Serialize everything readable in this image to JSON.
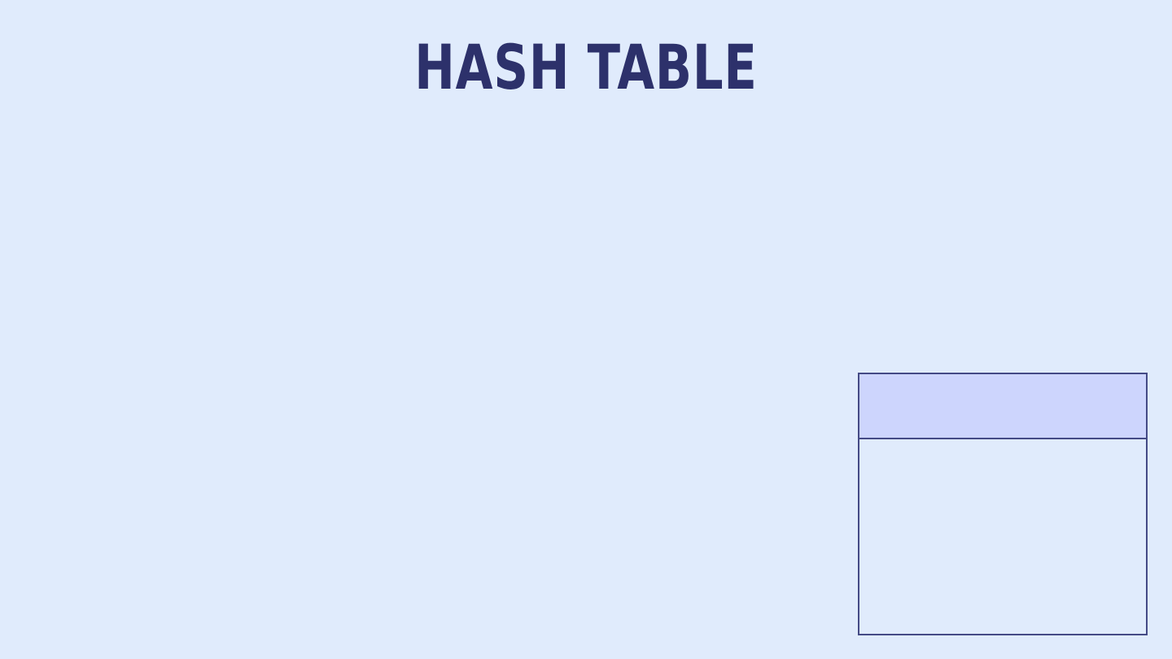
{
  "title": "Hash Table",
  "info_panel": {
    "header": "",
    "body": ""
  },
  "colors": {
    "background": "#e0ebfc",
    "title": "#2d316b",
    "panel_border": "#444a85",
    "panel_header": "#cdd5fd"
  }
}
